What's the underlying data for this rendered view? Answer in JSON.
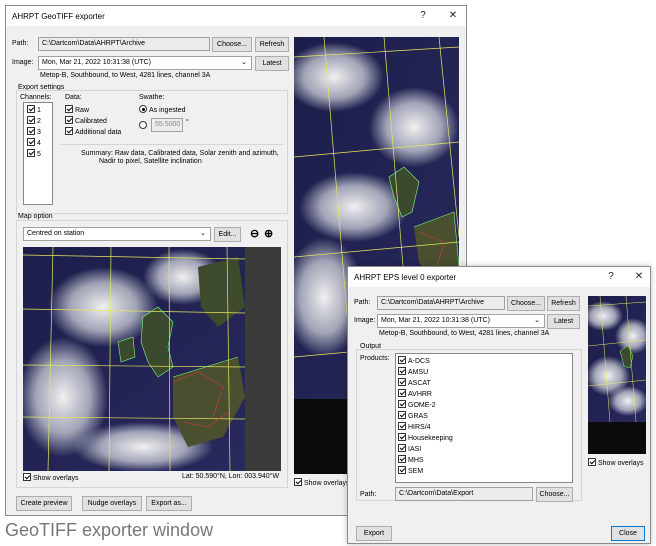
{
  "geotiff": {
    "title": "AHRPT GeoTIFF exporter",
    "help": "?",
    "close": "✕",
    "path_label": "Path:",
    "path_value": "C:\\Dartcom\\Data\\AHRPT\\Archive",
    "choose": "Choose...",
    "refresh": "Refresh",
    "image_label": "Image:",
    "image_value": "Mon, Mar 21, 2022     10:31:38 (UTC)",
    "latest": "Latest",
    "image_info": "Metop-B, Southbound, to West, 4281 lines, channel 3A",
    "export_settings": "Export settings",
    "channels_label": "Channels:",
    "channels": [
      "1",
      "2",
      "3",
      "4",
      "5"
    ],
    "data_label": "Data:",
    "data_options": [
      "Raw",
      "Calibrated",
      "Additional data"
    ],
    "swathe_label": "Swathe:",
    "as_ingested": "As ingested",
    "swathe_value": "55.5000",
    "degree": "°",
    "summary": "Summary: Raw data, Calibrated data, Solar zenith and azimuth,",
    "summary2": "Nadir to pixel, Satellite inclination",
    "map_option": "Map option",
    "map_select": "Centred on station",
    "edit": "Edit...",
    "show_overlays": "Show overlays",
    "latlon": "Lat: 50.590°N, Lon: 003.940°W",
    "show_overlays_right": "Show overlays",
    "create_preview": "Create preview",
    "nudge": "Nudge overlays",
    "export_as": "Export as...",
    "caption": "GeoTIFF exporter window"
  },
  "eps": {
    "title": "AHRPT EPS level 0 exporter",
    "help": "?",
    "close": "✕",
    "path_label": "Path:",
    "path_value": "C:\\Dartcom\\Data\\AHRPT\\Archive",
    "choose": "Choose...",
    "refresh": "Refresh",
    "image_label": "Image:",
    "image_value": "Mon, Mar 21, 2022     10:31:38 (UTC)",
    "latest": "Latest",
    "image_info": "Metop-B, Southbound, to West, 4281 lines, channel 3A",
    "output": "Output",
    "products_label": "Products:",
    "products": [
      "A-DCS",
      "AMSU",
      "ASCAT",
      "AVHRR",
      "GOME-2",
      "GRAS",
      "HIRS/4",
      "Housekeeping",
      "IASI",
      "MHS",
      "SEM"
    ],
    "out_path_label": "Path:",
    "out_path_value": "C:\\Dartcom\\Data\\Export",
    "out_choose": "Choose...",
    "show_overlays": "Show overlays",
    "export": "Export",
    "close_btn": "Close"
  }
}
